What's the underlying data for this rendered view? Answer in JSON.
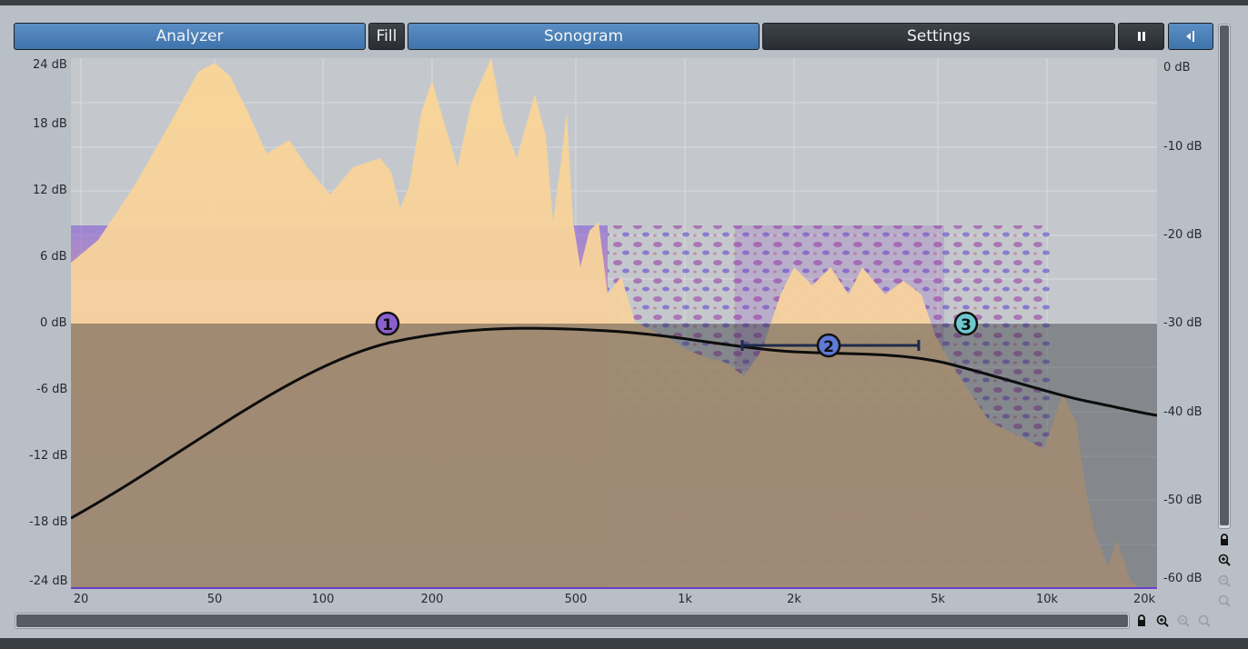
{
  "toolbar": {
    "analyzer_label": "Analyzer",
    "fill_label": "Fill",
    "sonogram_label": "Sonogram",
    "settings_label": "Settings",
    "pause_icon": "pause-icon",
    "collapse_icon": "collapse-panel-icon"
  },
  "axes": {
    "left_db": [
      "24 dB",
      "18 dB",
      "12 dB",
      "6 dB",
      "0 dB",
      "-6 dB",
      "-12 dB",
      "-18 dB",
      "-24 dB"
    ],
    "right_db": [
      "0 dB",
      "-10 dB",
      "-20 dB",
      "-30 dB",
      "-40 dB",
      "-50 dB",
      "-60 dB"
    ],
    "freq": [
      "20",
      "50",
      "100",
      "200",
      "500",
      "1k",
      "2k",
      "5k",
      "10k",
      "20k"
    ]
  },
  "eq_nodes": [
    {
      "label": "1",
      "frequency_hz": 150,
      "gain_db": 0,
      "color": "#8b5fcf"
    },
    {
      "label": "2",
      "frequency_hz": 2600,
      "gain_db": -2,
      "color": "#5f79d6"
    },
    {
      "label": "3",
      "frequency_hz": 6000,
      "gain_db": 0,
      "color": "#6ec9cf"
    }
  ],
  "colors": {
    "accent_blue": "#4a7fb8",
    "spectrum": "#f7cf8f",
    "curve": "#0d0d0d"
  },
  "icons": [
    "lock-icon",
    "zoom-in-icon",
    "zoom-out-icon",
    "zoom-reset-icon"
  ]
}
